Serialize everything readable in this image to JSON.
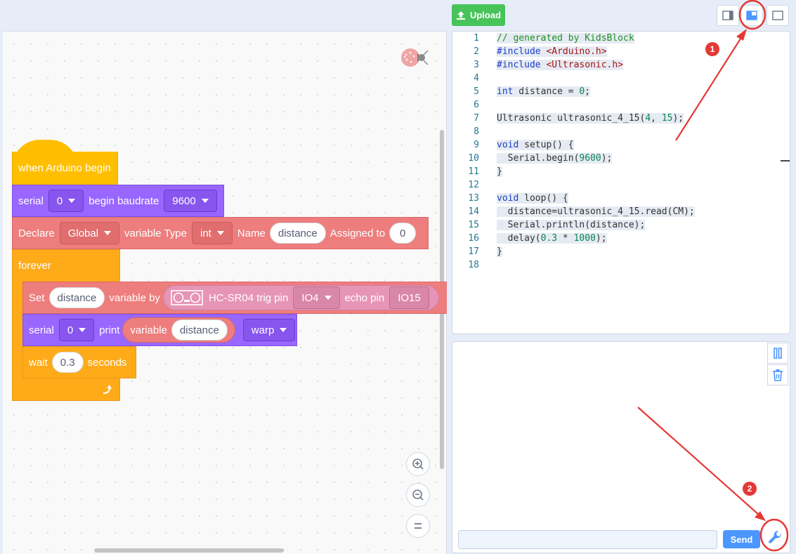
{
  "toolbar": {
    "upload_label": "Upload",
    "upload_icon": "upload-icon",
    "layout_buttons": [
      "layout-code-right-icon",
      "layout-split-icon",
      "layout-full-icon"
    ]
  },
  "blocks": {
    "hat": {
      "label": "when Arduino begin"
    },
    "serial_begin": {
      "label": "serial",
      "port": "0",
      "mid": "begin baudrate",
      "baud": "9600"
    },
    "declare": {
      "label": "Declare",
      "scope": "Global",
      "type_label": "variable Type",
      "type": "int",
      "name_label": "Name",
      "name": "distance",
      "assign_label": "Assigned to",
      "value": "0"
    },
    "forever": {
      "label": "forever"
    },
    "set": {
      "label": "Set",
      "var": "distance",
      "by_label": "variable by",
      "sensor_label": "HC-SR04 trig pin",
      "trig": "IO4",
      "echo_label": "echo pin",
      "echo": "IO15"
    },
    "print": {
      "label": "serial",
      "port": "0",
      "mid": "print",
      "var_label": "variable",
      "var": "distance",
      "mode": "warp"
    },
    "wait": {
      "label": "wait",
      "value": "0.3",
      "unit": "seconds"
    }
  },
  "code": {
    "lines": [
      {
        "n": "1",
        "t": "// generated by KidsBlock"
      },
      {
        "n": "2",
        "t": "#include <Arduino.h>"
      },
      {
        "n": "3",
        "t": "#include <Ultrasonic.h>"
      },
      {
        "n": "4",
        "t": ""
      },
      {
        "n": "5",
        "t": "int distance = 0;"
      },
      {
        "n": "6",
        "t": ""
      },
      {
        "n": "7",
        "t": "Ultrasonic ultrasonic_4_15(4, 15);"
      },
      {
        "n": "8",
        "t": ""
      },
      {
        "n": "9",
        "t": "void setup() {"
      },
      {
        "n": "10",
        "t": "  Serial.begin(9600);"
      },
      {
        "n": "11",
        "t": "}"
      },
      {
        "n": "12",
        "t": ""
      },
      {
        "n": "13",
        "t": "void loop() {"
      },
      {
        "n": "14",
        "t": "  distance=ultrasonic_4_15.read(CM);"
      },
      {
        "n": "15",
        "t": "  Serial.println(distance);"
      },
      {
        "n": "16",
        "t": "  delay(0.3 * 1000);"
      },
      {
        "n": "17",
        "t": "}"
      },
      {
        "n": "18",
        "t": ""
      }
    ]
  },
  "serial": {
    "send_label": "Send",
    "input_value": ""
  },
  "annotations": {
    "badge1": "1",
    "badge2": "2"
  },
  "colors": {
    "accent": "#4c97ff",
    "upload": "#48c35a",
    "annotation": "#e53935"
  }
}
